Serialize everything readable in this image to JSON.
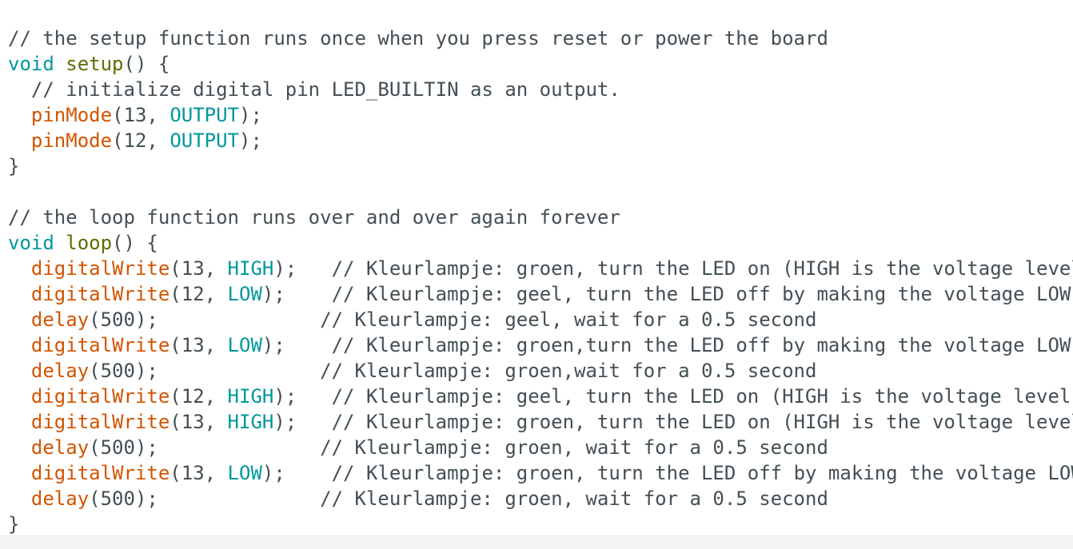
{
  "editor": {
    "colors": {
      "keyword": "#00979c",
      "function_name": "#5e6d03",
      "call": "#d35400",
      "constant": "#00979c",
      "text": "#434f54",
      "background": "#ffffff"
    },
    "lines": [
      [],
      [
        {
          "t": "// the setup function runs once when you press reset or power the board",
          "c": "cmt"
        }
      ],
      [
        {
          "t": "void",
          "c": "kw"
        },
        {
          "t": " ",
          "c": "plain"
        },
        {
          "t": "setup",
          "c": "fn"
        },
        {
          "t": "() {",
          "c": "plain"
        }
      ],
      [
        {
          "t": "  // initialize digital pin LED_BUILTIN as an output.",
          "c": "cmt"
        }
      ],
      [
        {
          "t": "  ",
          "c": "plain"
        },
        {
          "t": "pinMode",
          "c": "call"
        },
        {
          "t": "(13, ",
          "c": "plain"
        },
        {
          "t": "OUTPUT",
          "c": "const"
        },
        {
          "t": ");",
          "c": "plain"
        }
      ],
      [
        {
          "t": "  ",
          "c": "plain"
        },
        {
          "t": "pinMode",
          "c": "call"
        },
        {
          "t": "(12, ",
          "c": "plain"
        },
        {
          "t": "OUTPUT",
          "c": "const"
        },
        {
          "t": ");",
          "c": "plain"
        }
      ],
      [
        {
          "t": "}",
          "c": "plain"
        }
      ],
      [],
      [
        {
          "t": "// the loop function runs over and over again forever",
          "c": "cmt"
        }
      ],
      [
        {
          "t": "void",
          "c": "kw"
        },
        {
          "t": " ",
          "c": "plain"
        },
        {
          "t": "loop",
          "c": "fn"
        },
        {
          "t": "() {",
          "c": "plain"
        }
      ],
      [
        {
          "t": "  ",
          "c": "plain"
        },
        {
          "t": "digitalWrite",
          "c": "call"
        },
        {
          "t": "(13, ",
          "c": "plain"
        },
        {
          "t": "HIGH",
          "c": "const"
        },
        {
          "t": ");   // Kleurlampje: groen, turn the LED on (HIGH is the voltage level)",
          "c": "plain"
        }
      ],
      [
        {
          "t": "  ",
          "c": "plain"
        },
        {
          "t": "digitalWrite",
          "c": "call"
        },
        {
          "t": "(12, ",
          "c": "plain"
        },
        {
          "t": "LOW",
          "c": "const"
        },
        {
          "t": ");    // Kleurlampje: geel, turn the LED off by making the voltage LOW",
          "c": "plain"
        }
      ],
      [
        {
          "t": "  ",
          "c": "plain"
        },
        {
          "t": "delay",
          "c": "call"
        },
        {
          "t": "(500);              // Kleurlampje: geel, wait for a 0.5 second",
          "c": "plain"
        }
      ],
      [
        {
          "t": "  ",
          "c": "plain"
        },
        {
          "t": "digitalWrite",
          "c": "call"
        },
        {
          "t": "(13, ",
          "c": "plain"
        },
        {
          "t": "LOW",
          "c": "const"
        },
        {
          "t": ");    // Kleurlampje: groen,turn the LED off by making the voltage LOW",
          "c": "plain"
        }
      ],
      [
        {
          "t": "  ",
          "c": "plain"
        },
        {
          "t": "delay",
          "c": "call"
        },
        {
          "t": "(500);              // Kleurlampje: groen,wait for a 0.5 second",
          "c": "plain"
        }
      ],
      [
        {
          "t": "  ",
          "c": "plain"
        },
        {
          "t": "digitalWrite",
          "c": "call"
        },
        {
          "t": "(12, ",
          "c": "plain"
        },
        {
          "t": "HIGH",
          "c": "const"
        },
        {
          "t": ");   // Kleurlampje: geel, turn the LED on (HIGH is the voltage level)",
          "c": "plain"
        }
      ],
      [
        {
          "t": "  ",
          "c": "plain"
        },
        {
          "t": "digitalWrite",
          "c": "call"
        },
        {
          "t": "(13, ",
          "c": "plain"
        },
        {
          "t": "HIGH",
          "c": "const"
        },
        {
          "t": ");   // Kleurlampje: groen, turn the LED on (HIGH is the voltage level)",
          "c": "plain"
        }
      ],
      [
        {
          "t": "  ",
          "c": "plain"
        },
        {
          "t": "delay",
          "c": "call"
        },
        {
          "t": "(500);              // Kleurlampje: groen, wait for a 0.5 second",
          "c": "plain"
        }
      ],
      [
        {
          "t": "  ",
          "c": "plain"
        },
        {
          "t": "digitalWrite",
          "c": "call"
        },
        {
          "t": "(13, ",
          "c": "plain"
        },
        {
          "t": "LOW",
          "c": "const"
        },
        {
          "t": ");    // Kleurlampje: groen, turn the LED off by making the voltage LOW",
          "c": "plain"
        }
      ],
      [
        {
          "t": "  ",
          "c": "plain"
        },
        {
          "t": "delay",
          "c": "call"
        },
        {
          "t": "(500);              // Kleurlampje: groen, wait for a 0.5 second",
          "c": "plain"
        }
      ],
      [
        {
          "t": "}",
          "c": "plain"
        }
      ]
    ]
  }
}
